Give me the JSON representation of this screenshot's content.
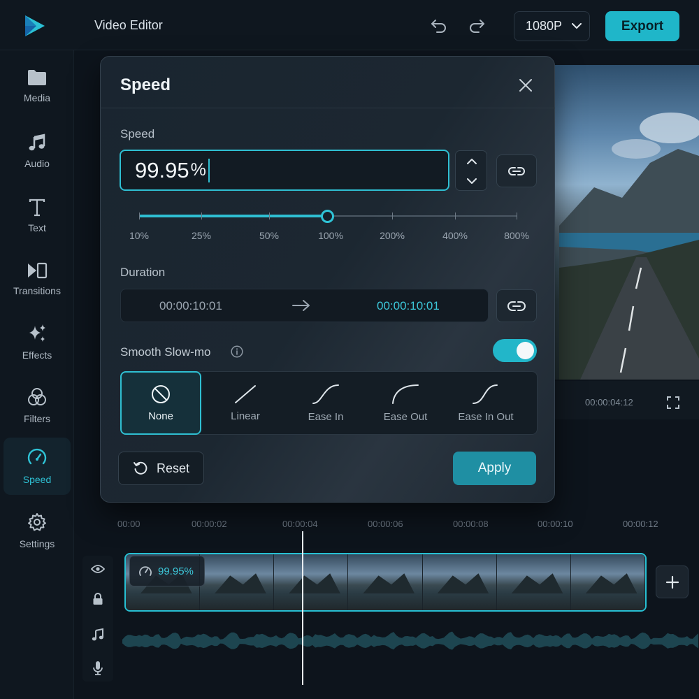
{
  "header": {
    "title": "Video Editor",
    "resolution": "1080P",
    "export_label": "Export"
  },
  "sidebar": {
    "items": [
      {
        "label": "Media",
        "icon": "folder-icon"
      },
      {
        "label": "Audio",
        "icon": "music-note-icon"
      },
      {
        "label": "Text",
        "icon": "text-icon"
      },
      {
        "label": "Transitions",
        "icon": "transitions-icon"
      },
      {
        "label": "Effects",
        "icon": "sparkles-icon"
      },
      {
        "label": "Filters",
        "icon": "filters-icon"
      },
      {
        "label": "Speed",
        "icon": "speedometer-icon",
        "active": true
      },
      {
        "label": "Settings",
        "icon": "gear-icon"
      }
    ]
  },
  "preview": {
    "timecode": "00:00:04:12"
  },
  "dialog": {
    "title": "Speed",
    "speed_label": "Speed",
    "speed_value": "99.95",
    "speed_unit": "%",
    "slider_ticks": [
      "10%",
      "25%",
      "50%",
      "100%",
      "200%",
      "400%",
      "800%"
    ],
    "slider_position_tick": 3,
    "duration_label": "Duration",
    "duration_from": "00:00:10:01",
    "duration_to": "00:00:10:01",
    "smooth_label": "Smooth Slow-mo",
    "smooth_enabled": true,
    "curves": [
      {
        "label": "None",
        "active": true
      },
      {
        "label": "Linear"
      },
      {
        "label": "Ease In"
      },
      {
        "label": "Ease Out"
      },
      {
        "label": "Ease In Out"
      }
    ],
    "reset_label": "Reset",
    "apply_label": "Apply"
  },
  "timeline": {
    "ruler": [
      "00:00",
      "00:00:02",
      "00:00:04",
      "00:00:06",
      "00:00:08",
      "00:00:10",
      "00:00:12"
    ],
    "clip_speed": "99.95%"
  },
  "colors": {
    "accent": "#2fbfd2",
    "export_bg": "#1fb6c9",
    "background": "#0d141c"
  }
}
